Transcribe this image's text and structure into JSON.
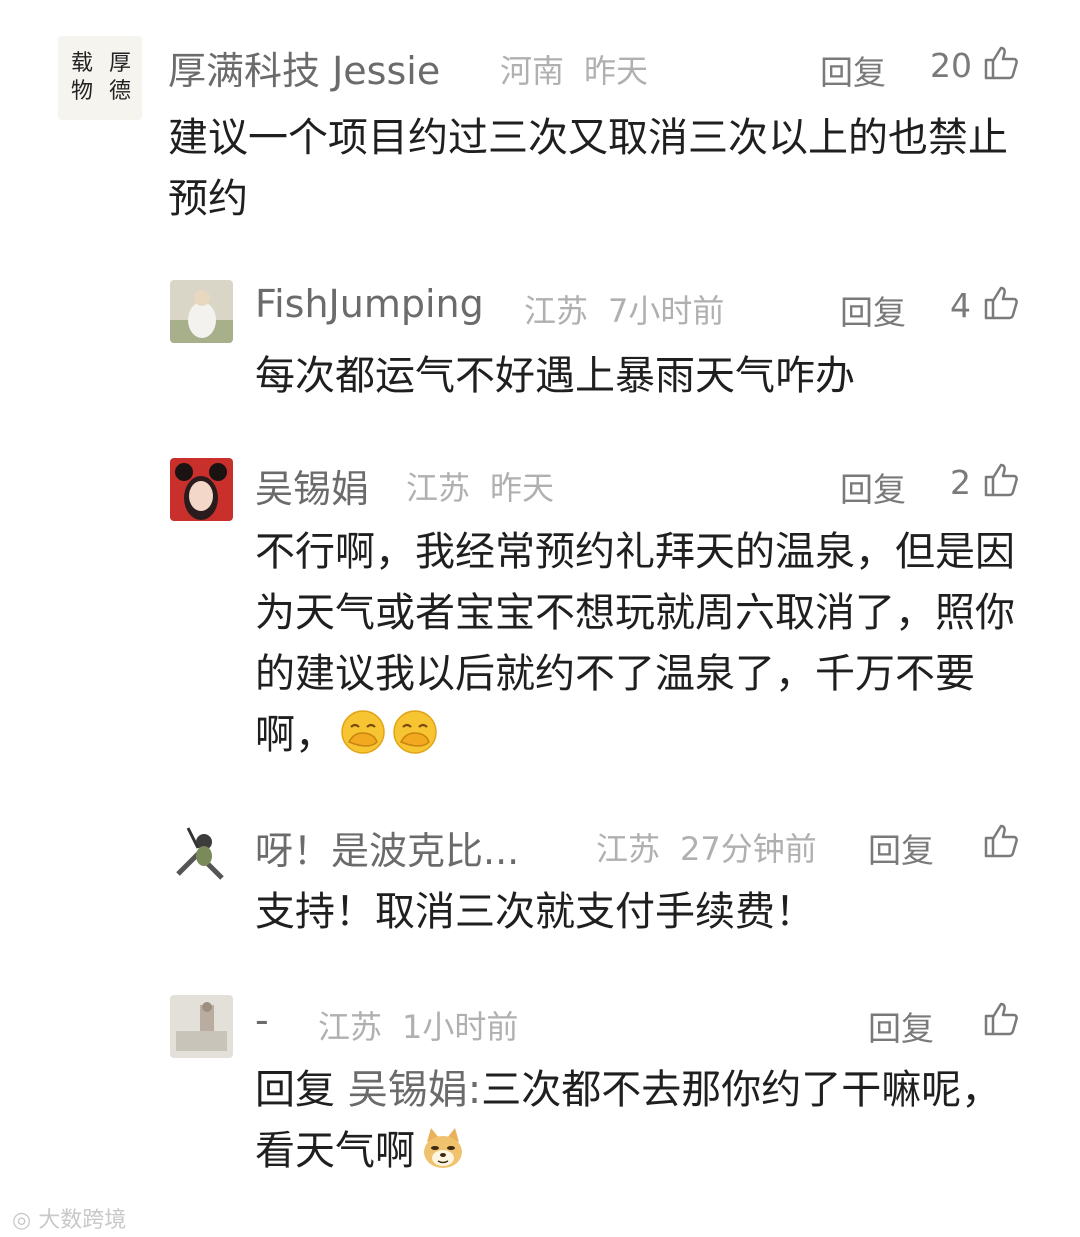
{
  "comments": [
    {
      "name": "厚满科技 Jessie",
      "region": "河南",
      "time": "昨天",
      "reply_label": "回复",
      "likes": "20",
      "avatar_label": "厚德载物",
      "text": "建议一个项目约过三次又取消三次以上的也禁止预约"
    },
    {
      "name": "FishJumping",
      "region": "江苏",
      "time": "7小时前",
      "reply_label": "回复",
      "likes": "4",
      "text": "每次都运气不好遇上暴雨天气咋办"
    },
    {
      "name": "吴锡娟",
      "region": "江苏",
      "time": "昨天",
      "reply_label": "回复",
      "likes": "2",
      "text": "不行啊，我经常预约礼拜天的温泉，但是因为天气或者宝宝不想玩就周六取消了，照你的建议我以后就约不了温泉了，千万不要啊，",
      "emoji": "hand-over-mouth-emoji"
    },
    {
      "name": "呀！是波克比...",
      "region": "江苏",
      "time": "27分钟前",
      "reply_label": "回复",
      "likes": "",
      "text": "支持！取消三次就支付手续费！"
    },
    {
      "name": "-",
      "region": "江苏",
      "time": "1小时前",
      "reply_label": "回复",
      "likes": "",
      "reply_prefix": "回复 ",
      "reply_target": "吴锡娟:",
      "text": "三次都不去那你约了干嘛呢，看天气啊",
      "emoji": "doge-emoji"
    }
  ],
  "watermark": "大数跨境",
  "colors": {
    "name": "#6b6b6b",
    "meta": "#b0b0b0",
    "text": "#1f1f1f"
  }
}
